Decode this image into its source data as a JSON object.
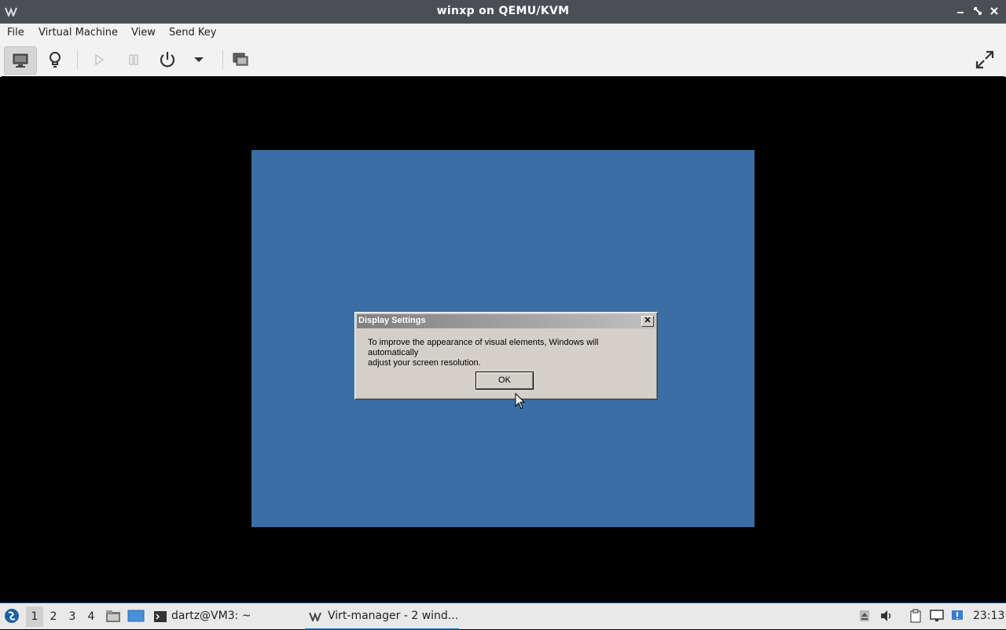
{
  "window": {
    "title": "winxp on QEMU/KVM"
  },
  "menu": [
    "File",
    "Virtual Machine",
    "View",
    "Send Key"
  ],
  "dialog": {
    "title": "Display Settings",
    "message_line1": "To improve the appearance of visual elements, Windows will automatically",
    "message_line2": "adjust your screen resolution.",
    "ok_label": "OK",
    "close_glyph": "✕"
  },
  "taskbar": {
    "workspaces": [
      "1",
      "2",
      "3",
      "4"
    ],
    "terminal_task": "dartz@VM3: ~",
    "virt_task": "Virt-manager - 2 wind...",
    "clock": "23:13"
  },
  "colors": {
    "guest_desktop": "#3a6ea5",
    "titlebar": "#4b4f55",
    "accent": "#1f5fa3"
  }
}
